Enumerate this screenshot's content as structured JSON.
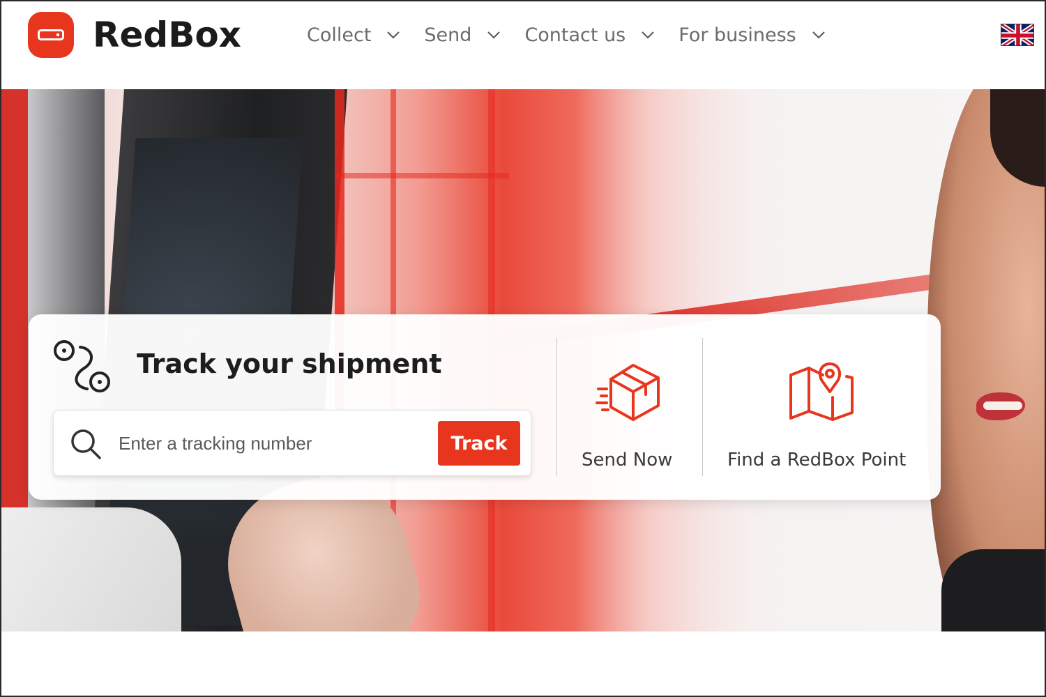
{
  "brand": {
    "name": "RedBox",
    "accent": "#e8361e"
  },
  "nav": {
    "items": [
      {
        "label": "Collect"
      },
      {
        "label": "Send"
      },
      {
        "label": "Contact us"
      },
      {
        "label": "For business"
      }
    ],
    "language_flag": "uk-flag-icon"
  },
  "tracking": {
    "title": "Track your shipment",
    "placeholder": "Enter a tracking number",
    "value": "",
    "button_label": "Track"
  },
  "actions": [
    {
      "label": "Send Now",
      "icon": "package-icon"
    },
    {
      "label": "Find a RedBox Point",
      "icon": "map-pin-icon"
    }
  ]
}
